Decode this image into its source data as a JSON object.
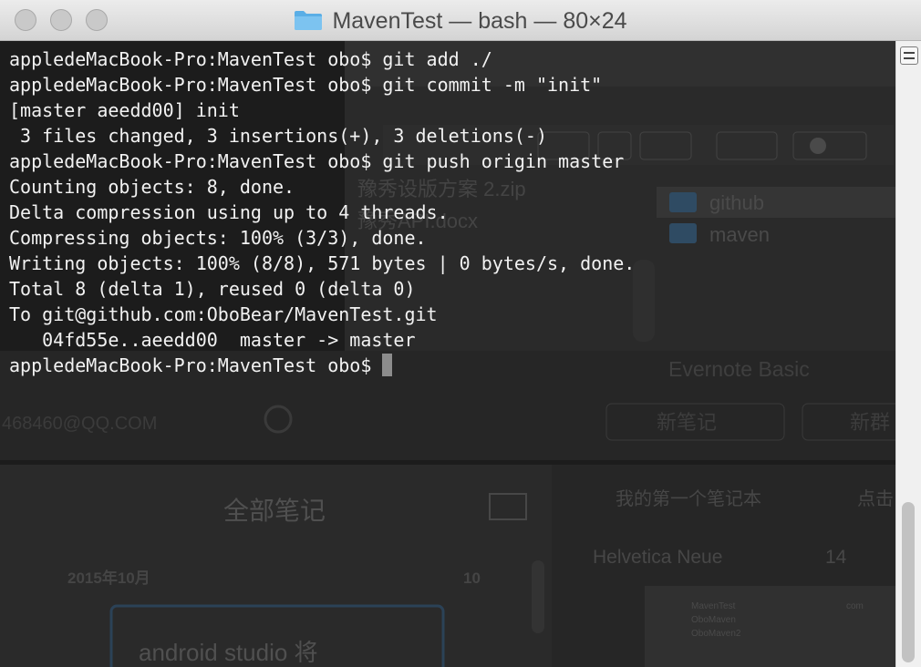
{
  "window": {
    "title": "MavenTest — bash — 80×24"
  },
  "terminal": {
    "lines": [
      "appledeMacBook-Pro:MavenTest obo$ git add ./",
      "appledeMacBook-Pro:MavenTest obo$ git commit -m \"init\"",
      "[master aeedd00] init",
      " 3 files changed, 3 insertions(+), 3 deletions(-)",
      "appledeMacBook-Pro:MavenTest obo$ git push origin master",
      "Counting objects: 8, done.",
      "Delta compression using up to 4 threads.",
      "Compressing objects: 100% (3/3), done.",
      "Writing objects: 100% (8/8), 571 bytes | 0 bytes/s, done.",
      "Total 8 (delta 1), reused 0 (delta 0)",
      "To git@github.com:OboBear/MavenTest.git",
      "   04fd55e..aeedd00  master -> master"
    ],
    "prompt": "appledeMacBook-Pro:MavenTest obo$ "
  },
  "background": {
    "file_1": "豫秀设版方案 2.zip",
    "file_2": "豫秀API.docx",
    "folder_1": "github",
    "folder_2": "maven",
    "evernote_title": "Evernote Basic",
    "account": "468460@QQ.COM",
    "new_note": "新笔记",
    "new_chat": "新群",
    "all_notes": "全部笔记",
    "notebook": "我的第一个笔记本",
    "click_hint": "点击",
    "font_name": "Helvetica Neue",
    "font_size": "14",
    "month": "2015年10月",
    "count": "10",
    "note_preview": "android studio 将",
    "mini_1": "MavenTest",
    "mini_2": "OboMaven",
    "mini_3": "OboMaven2",
    "mini_4": "com"
  },
  "colors": {
    "terminal_bg": "#1c1c1c",
    "terminal_fg": "#f2f2f2",
    "titlebar": "#e0e0e0",
    "folder_icon": "#5aaee6"
  }
}
